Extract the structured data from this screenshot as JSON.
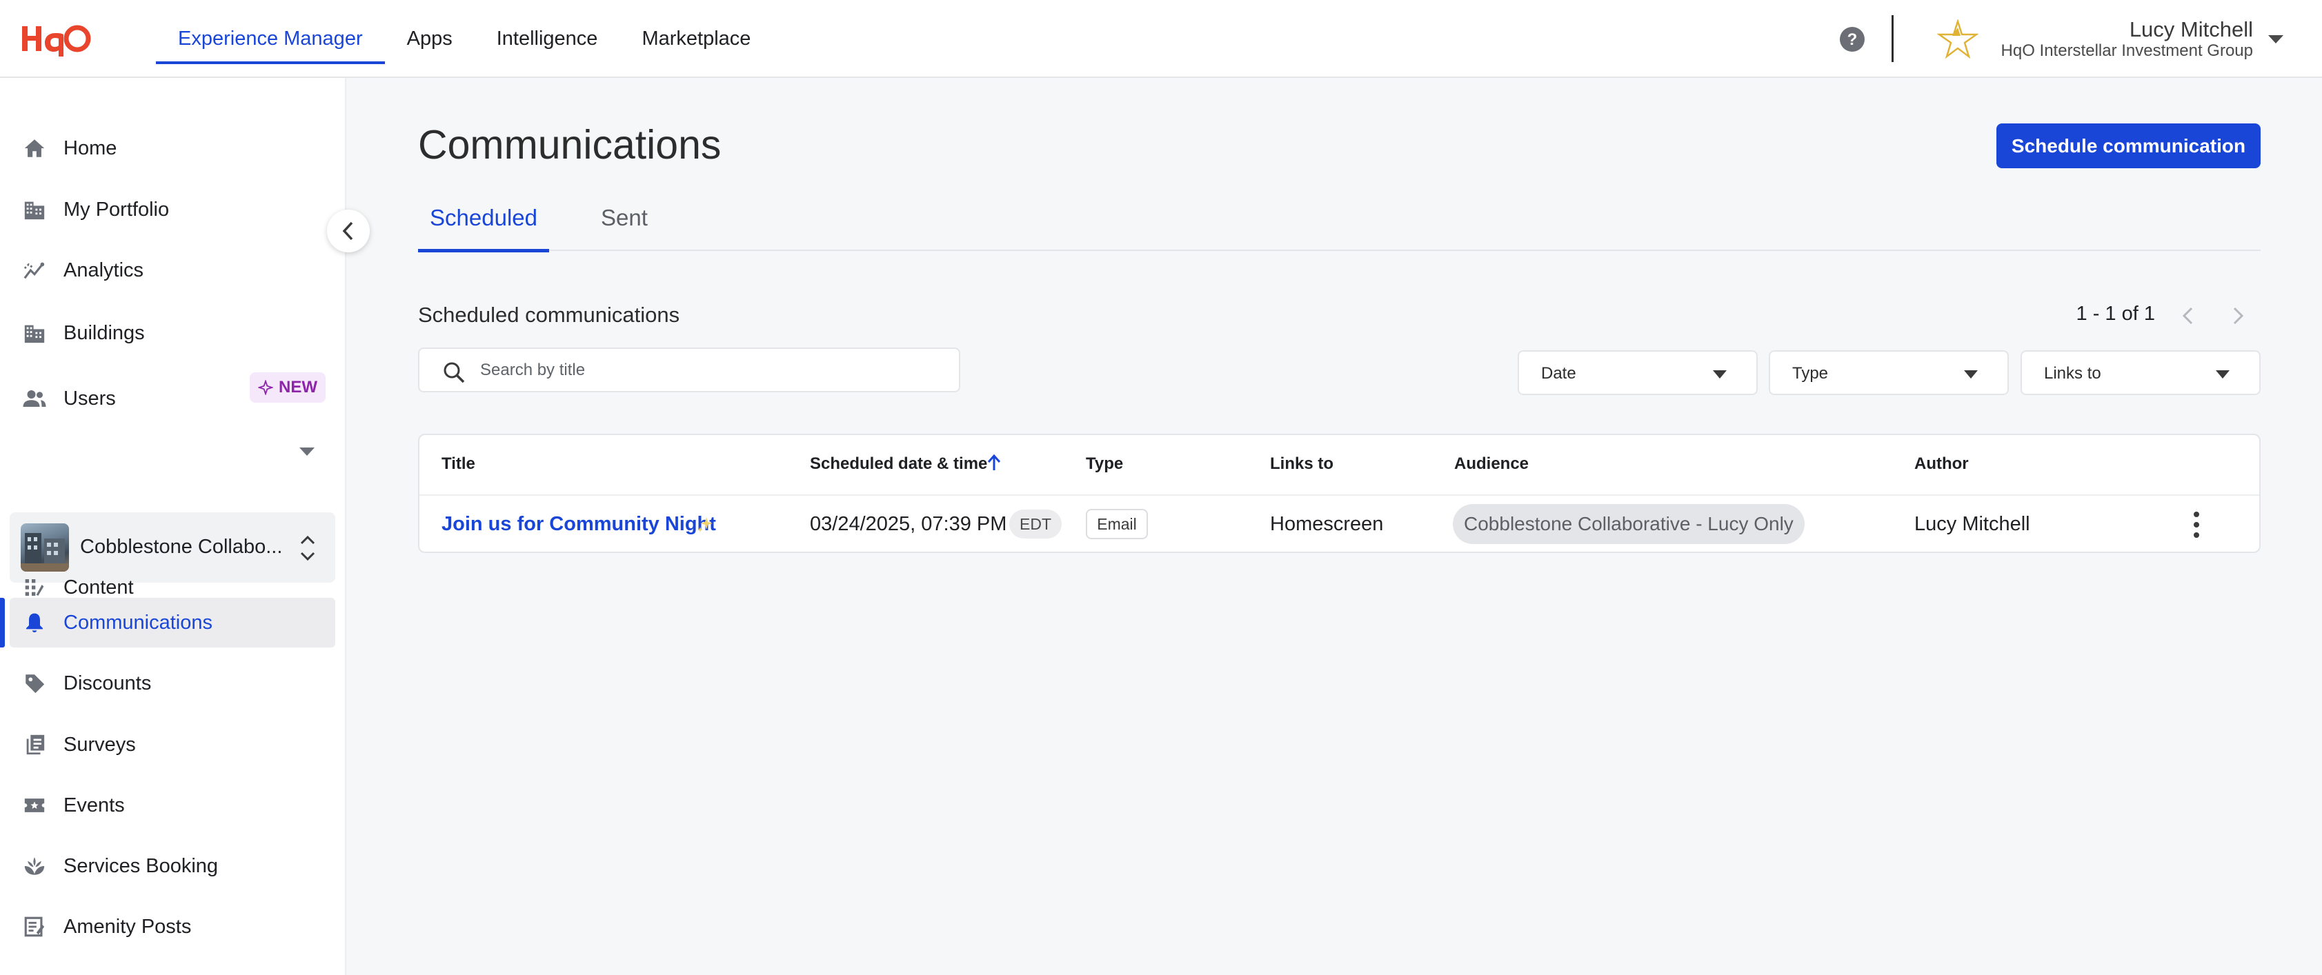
{
  "brand": {
    "logo_text": "HqO",
    "accent_color": "#1a46d8",
    "logo_color": "#e8452c"
  },
  "topnav": {
    "items": [
      {
        "label": "Experience Manager",
        "active": true
      },
      {
        "label": "Apps",
        "active": false
      },
      {
        "label": "Intelligence",
        "active": false
      },
      {
        "label": "Marketplace",
        "active": false
      }
    ]
  },
  "user": {
    "name": "Lucy Mitchell",
    "org": "HqO Interstellar Investment Group"
  },
  "sidebar": {
    "items": [
      {
        "label": "Home",
        "icon": "home-icon"
      },
      {
        "label": "My Portfolio",
        "icon": "portfolio-icon"
      },
      {
        "label": "Analytics",
        "icon": "analytics-icon"
      },
      {
        "label": "Buildings",
        "icon": "buildings-icon",
        "badge": "NEW"
      },
      {
        "label": "Users",
        "icon": "users-icon"
      },
      {
        "label": "Content",
        "icon": "content-icon"
      },
      {
        "label": "Communications",
        "icon": "bell-icon",
        "active": true
      },
      {
        "label": "Discounts",
        "icon": "tag-icon"
      },
      {
        "label": "Surveys",
        "icon": "surveys-icon"
      },
      {
        "label": "Events",
        "icon": "events-icon"
      },
      {
        "label": "Services Booking",
        "icon": "services-icon"
      },
      {
        "label": "Amenity Posts",
        "icon": "amenity-posts-icon"
      }
    ],
    "building_selector": {
      "name": "Cobblestone Collabo..."
    }
  },
  "main": {
    "title": "Communications",
    "primary_button": "Schedule communication",
    "tabs": [
      {
        "label": "Scheduled",
        "active": true
      },
      {
        "label": "Sent",
        "active": false
      }
    ],
    "section_title": "Scheduled communications",
    "pagination": "1 - 1 of 1",
    "search": {
      "placeholder": "Search by title",
      "value": ""
    },
    "filters": [
      {
        "label": "Date"
      },
      {
        "label": "Type"
      },
      {
        "label": "Links to"
      }
    ],
    "table": {
      "columns": [
        "Title",
        "Scheduled date & time",
        "Type",
        "Links to",
        "Audience",
        "Author"
      ],
      "sort": {
        "column": "Scheduled date & time",
        "direction": "ascending"
      },
      "rows": [
        {
          "title": "Join us for Community Night",
          "datetime": "03/24/2025, 07:39 PM",
          "timezone": "EDT",
          "type": "Email",
          "links_to": "Homescreen",
          "audience": "Cobblestone Collaborative - Lucy Only",
          "author": "Lucy Mitchell"
        }
      ]
    }
  }
}
